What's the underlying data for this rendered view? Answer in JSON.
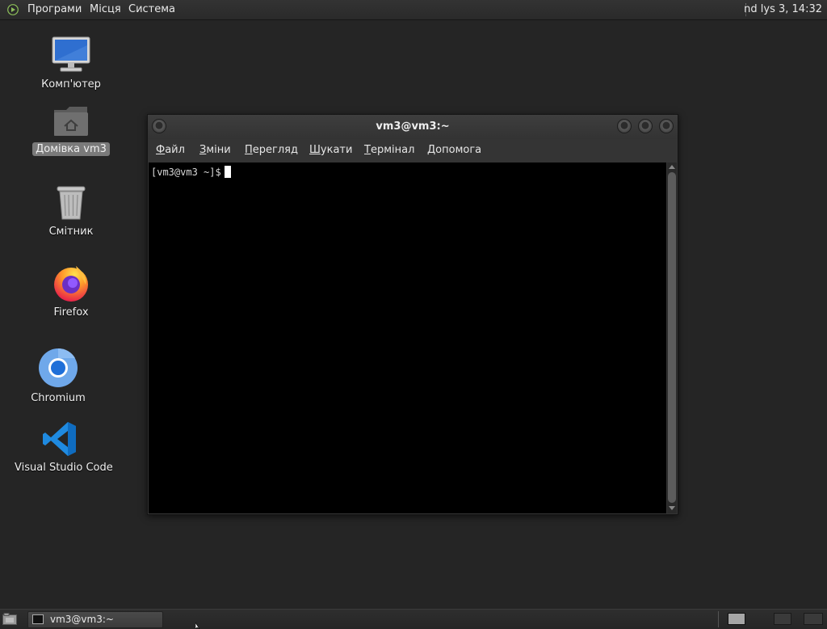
{
  "top_panel": {
    "menu": [
      "Програми",
      "Місця",
      "Система"
    ],
    "clock": "nd lys 3, 14:32"
  },
  "desktop": {
    "icons": [
      {
        "label": "Комп'ютер",
        "icon": "computer-icon"
      },
      {
        "label": "Домівка vm3",
        "icon": "home-folder-icon",
        "selected": true
      },
      {
        "label": "Смітник",
        "icon": "trash-icon"
      },
      {
        "label": "Firefox",
        "icon": "firefox-icon"
      },
      {
        "label": "Chromium",
        "icon": "chromium-icon"
      },
      {
        "label": "Visual Studio Code",
        "icon": "vscode-icon"
      }
    ]
  },
  "terminal": {
    "title": "vm3@vm3:~",
    "menu": [
      {
        "mnemonic": "Ф",
        "rest": "айл"
      },
      {
        "mnemonic": "З",
        "rest": "міни"
      },
      {
        "mnemonic": "П",
        "rest": "ерегляд"
      },
      {
        "mnemonic": "Ш",
        "rest": "укати"
      },
      {
        "mnemonic": "Т",
        "rest": "ермінал"
      },
      {
        "mnemonic": "Д",
        "rest": "опомога"
      }
    ],
    "prompt": "[vm3@vm3 ~]$"
  },
  "taskbar": {
    "items": [
      {
        "label": "vm3@vm3:~",
        "icon": "terminal-icon"
      }
    ],
    "workspaces": 3,
    "active_workspace": 1
  },
  "colors": {
    "desktop_bg": "#252525",
    "panel_bg": "#2e2e2e",
    "terminal_bg": "#000000",
    "selection_bg": "#7a7a7a"
  }
}
